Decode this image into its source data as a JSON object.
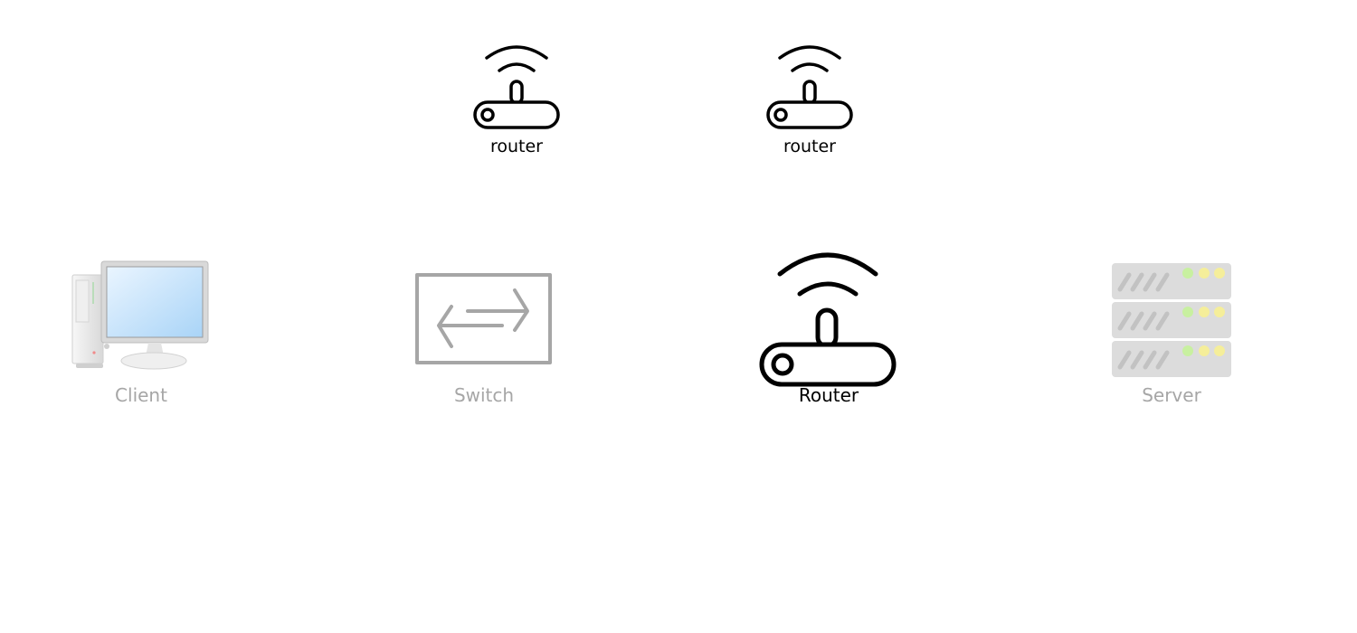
{
  "nodes": {
    "router_top_left": {
      "label": "router",
      "icon": "router-icon"
    },
    "router_top_right": {
      "label": "router",
      "icon": "router-icon"
    },
    "client": {
      "label": "Client",
      "icon": "desktop-computer-icon"
    },
    "switch": {
      "label": "Switch",
      "icon": "switch-icon"
    },
    "router_main": {
      "label": "Router",
      "icon": "router-icon"
    },
    "server": {
      "label": "Server",
      "icon": "server-rack-icon"
    }
  },
  "colors": {
    "active": "#000000",
    "inactive": "#a6a6a6",
    "led_green": "#c8f0a0",
    "led_yellow": "#f5ee9a"
  }
}
